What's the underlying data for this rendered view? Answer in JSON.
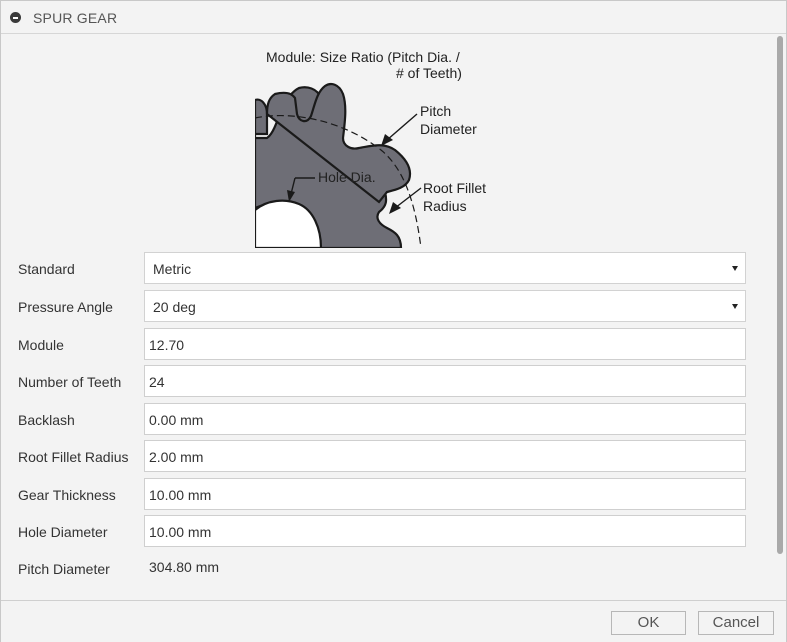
{
  "panel": {
    "title": "SPUR GEAR"
  },
  "diagram": {
    "module_title_line1": "Module: Size Ratio (Pitch Dia. /",
    "module_title_line2": "# of Teeth)",
    "pitch_line1": "Pitch",
    "pitch_line2": "Diameter",
    "hole_label": "Hole Dia.",
    "root_line1": "Root Fillet",
    "root_line2": "Radius",
    "gear_color": "#6e6e76"
  },
  "fields": {
    "standard": {
      "label": "Standard",
      "value": "Metric"
    },
    "pressure_angle": {
      "label": "Pressure Angle",
      "value": "20 deg"
    },
    "module": {
      "label": "Module",
      "value": "12.70"
    },
    "number_of_teeth": {
      "label": "Number of Teeth",
      "value": "24"
    },
    "backlash": {
      "label": "Backlash",
      "value": "0.00 mm"
    },
    "root_fillet_radius": {
      "label": "Root Fillet Radius",
      "value": "2.00 mm"
    },
    "gear_thickness": {
      "label": "Gear Thickness",
      "value": "10.00 mm"
    },
    "hole_diameter": {
      "label": "Hole Diameter",
      "value": "10.00 mm"
    },
    "pitch_diameter": {
      "label": "Pitch Diameter",
      "value": "304.80 mm"
    }
  },
  "buttons": {
    "ok": "OK",
    "cancel": "Cancel"
  }
}
